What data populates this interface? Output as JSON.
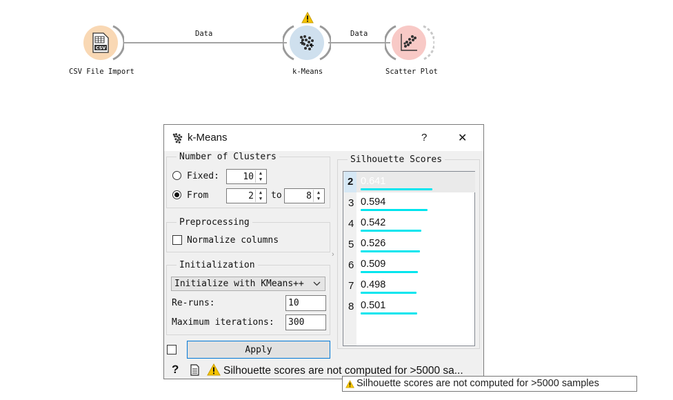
{
  "workflow": {
    "nodes": [
      {
        "label": "CSV File Import",
        "icon": "csv-file-icon",
        "color": "#f9d8b4"
      },
      {
        "label": "k-Means",
        "icon": "kmeans-clusters-icon",
        "color": "#cfe0ee",
        "warning": true
      },
      {
        "label": "Scatter Plot",
        "icon": "scatter-plot-icon",
        "color": "#f8c9c6"
      }
    ],
    "links": [
      "Data",
      "Data"
    ]
  },
  "dialog": {
    "title": "k-Means",
    "help_button": "?",
    "close_button": "✕",
    "clusters": {
      "group_title": "Number of Clusters",
      "fixed_label": "Fixed:",
      "fixed_value": "10",
      "from_label": "From",
      "from_value": "2",
      "to_label": "to",
      "to_value": "8",
      "selected": "from"
    },
    "preprocessing": {
      "group_title": "Preprocessing",
      "normalize_label": "Normalize columns",
      "normalize_checked": false
    },
    "initialization": {
      "group_title": "Initialization",
      "method": "Initialize with KMeans++",
      "reruns_label": "Re-runs:",
      "reruns_value": "10",
      "maxiter_label": "Maximum iterations:",
      "maxiter_value": "300"
    },
    "silhouette": {
      "group_title": "Silhouette Scores",
      "rows": [
        {
          "k": "2",
          "score": "0.641",
          "selected": true
        },
        {
          "k": "3",
          "score": "0.594"
        },
        {
          "k": "4",
          "score": "0.542"
        },
        {
          "k": "5",
          "score": "0.526"
        },
        {
          "k": "6",
          "score": "0.509"
        },
        {
          "k": "7",
          "score": "0.498"
        },
        {
          "k": "8",
          "score": "0.501"
        }
      ],
      "bar_color": "#00e5ee",
      "selected_color": "#d6e8f5"
    },
    "auto_apply_checked": false,
    "apply_label": "Apply",
    "status_text": "Silhouette scores are not computed for >5000 sa..."
  },
  "tooltip": {
    "text": "Silhouette scores are not computed for >5000 samples"
  }
}
